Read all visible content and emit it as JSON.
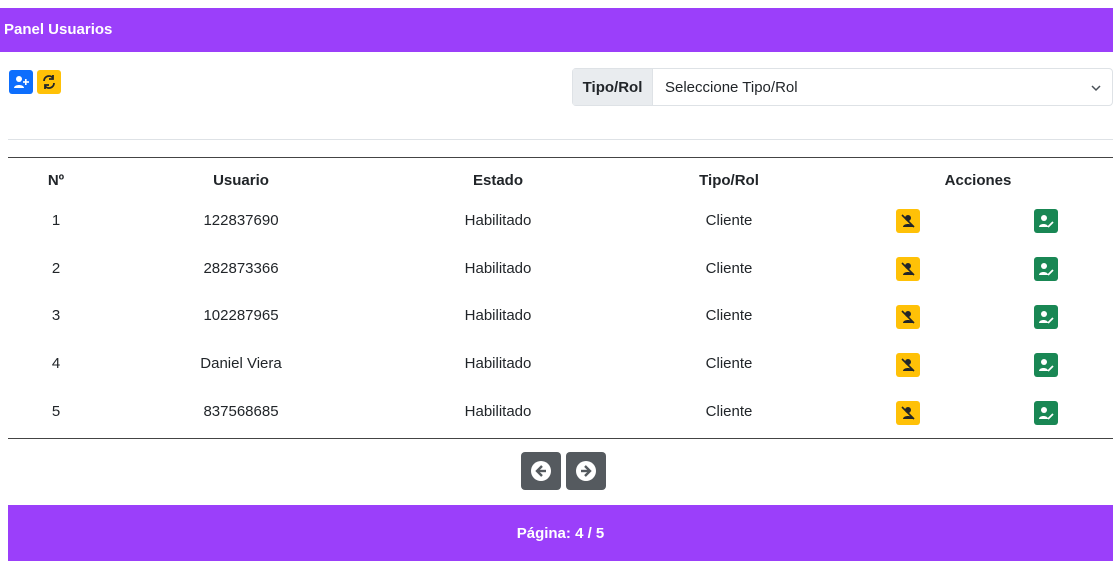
{
  "header": {
    "title": "Panel Usuarios"
  },
  "toolbar": {
    "add_user_icon": "user-plus-icon",
    "refresh_icon": "refresh-icon",
    "add_color": "#0d6efd",
    "refresh_color": "#ffc107"
  },
  "filter": {
    "label": "Tipo/Rol",
    "selected": "Seleccione Tipo/Rol"
  },
  "table": {
    "headers": [
      "Nº",
      "Usuario",
      "Estado",
      "Tipo/Rol",
      "Acciones"
    ],
    "rows": [
      {
        "n": "1",
        "usuario": "122837690",
        "estado": "Habilitado",
        "rol": "Cliente"
      },
      {
        "n": "2",
        "usuario": "282873366",
        "estado": "Habilitado",
        "rol": "Cliente"
      },
      {
        "n": "3",
        "usuario": "102287965",
        "estado": "Habilitado",
        "rol": "Cliente"
      },
      {
        "n": "4",
        "usuario": "Daniel Viera",
        "estado": "Habilitado",
        "rol": "Cliente"
      },
      {
        "n": "5",
        "usuario": "837568685",
        "estado": "Habilitado",
        "rol": "Cliente"
      }
    ],
    "actions": {
      "disable_icon": "user-slash-icon",
      "edit_icon": "user-edit-icon"
    }
  },
  "pagination": {
    "prev_icon": "arrow-left-circle-icon",
    "next_icon": "arrow-right-circle-icon",
    "page_text": "Página: 4 / 5"
  },
  "colors": {
    "brand": "#9b3ffa",
    "warning": "#ffc107",
    "success": "#198754",
    "primary": "#0d6efd",
    "secondary": "#555a5f"
  }
}
